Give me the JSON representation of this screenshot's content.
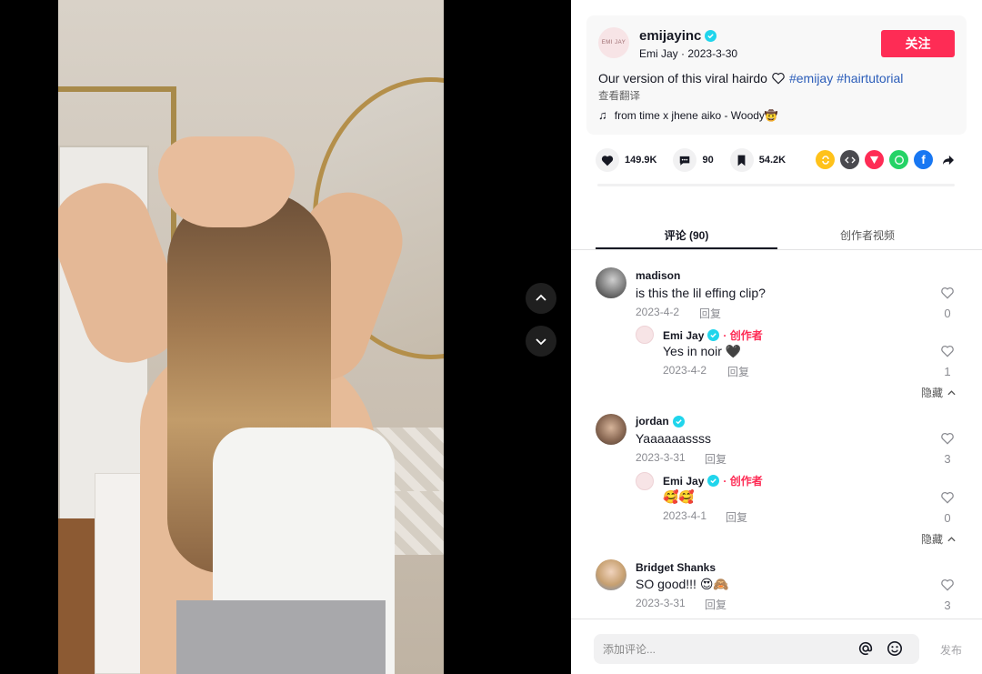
{
  "colors": {
    "brand": "#fe2c55",
    "verified": "#20d5ec",
    "hashtag": "#2b5db9"
  },
  "post": {
    "author_username": "emijayinc",
    "author_display": "Emi Jay",
    "post_date": "2023-3-30",
    "follow_label": "关注",
    "caption_text": "Our version of this viral hairdo",
    "hashtags": [
      "#emijay",
      "#hairtutorial"
    ],
    "translate_label": "查看翻译",
    "music": "from time x jhene aiko - Woody🤠",
    "avatar_logo_text": "EMI JAY"
  },
  "actions": {
    "likes": "149.9K",
    "comments": "90",
    "saves": "54.2K"
  },
  "share_icons": [
    "repost-icon",
    "embed-icon",
    "send-icon",
    "whatsapp-icon",
    "facebook-icon",
    "share-arrow-icon"
  ],
  "tabs": {
    "comments_label": "评论 (90)",
    "creator_label": "创作者视频"
  },
  "comments": [
    {
      "user": "madison",
      "text": "is this the lil effing clip?",
      "date": "2023-4-2",
      "reply_label": "回复",
      "likes": "0",
      "reply": {
        "user": "Emi Jay",
        "creator_label": "· 创作者",
        "text": "Yes in noir 🖤",
        "date": "2023-4-2",
        "reply_label": "回复",
        "likes": "1"
      },
      "hide_label": "隐藏"
    },
    {
      "user": "jordan",
      "text": "Yaaaaaassss",
      "date": "2023-3-31",
      "reply_label": "回复",
      "likes": "3",
      "reply": {
        "user": "Emi Jay",
        "creator_label": "· 创作者",
        "text": "🥰🥰",
        "date": "2023-4-1",
        "reply_label": "回复",
        "likes": "0"
      },
      "hide_label": "隐藏"
    },
    {
      "user": "Bridget Shanks",
      "text": "SO good!!! 😍🙈",
      "date": "2023-3-31",
      "reply_label": "回复",
      "likes": "3"
    }
  ],
  "comment_bar": {
    "placeholder": "添加评论...",
    "post_label": "发布"
  }
}
